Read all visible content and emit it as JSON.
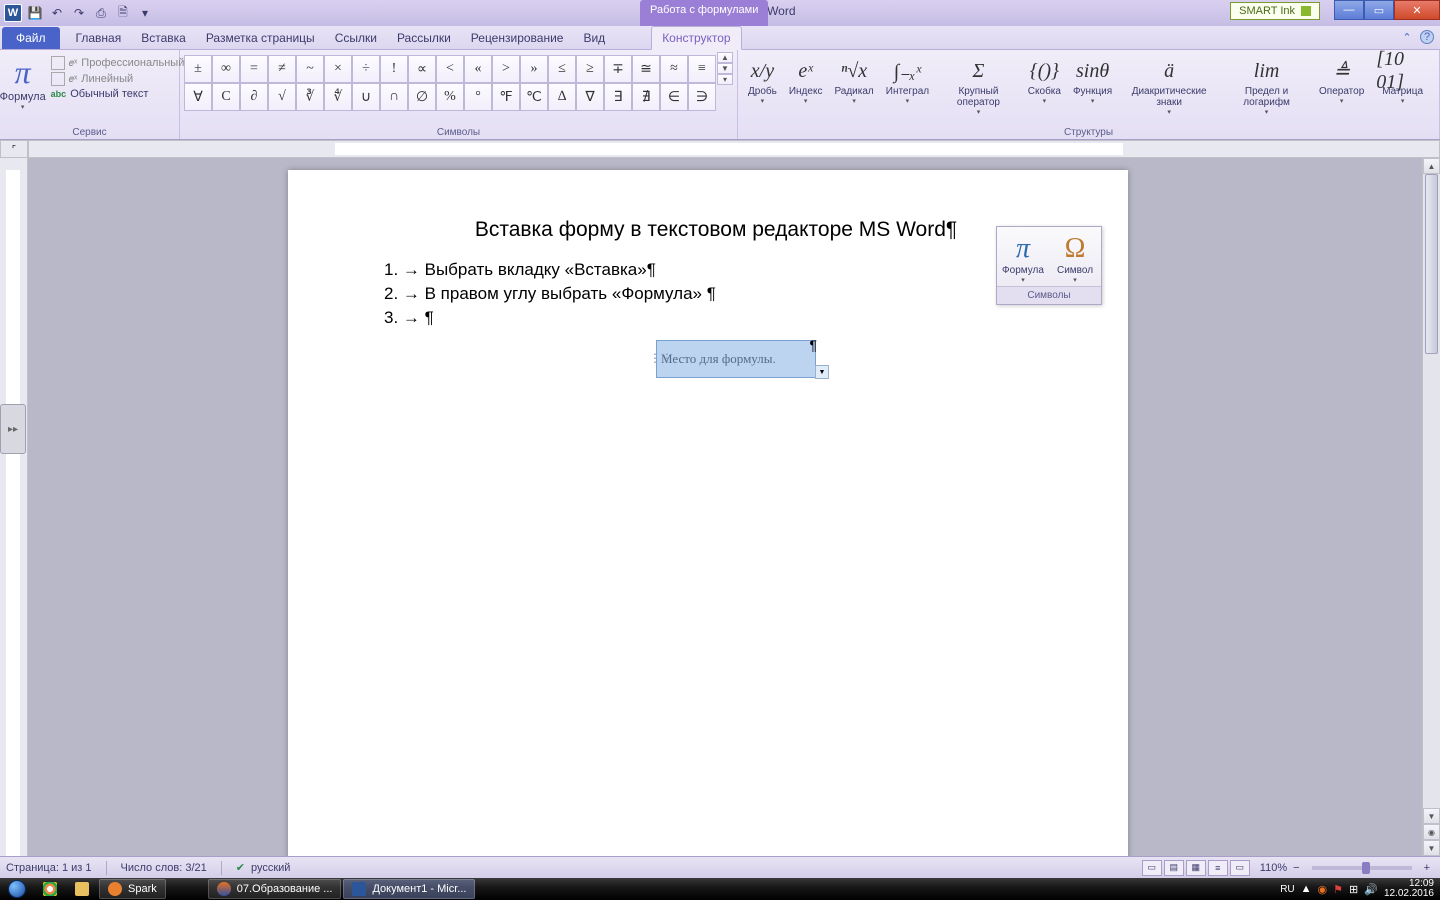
{
  "titlebar": {
    "word_badge": "W",
    "doc_title": "Документ1 - Microsoft Word",
    "context_tab": "Работа с формулами",
    "smartink": "SMART Ink"
  },
  "tabs": {
    "file": "Файл",
    "items": [
      "Главная",
      "Вставка",
      "Разметка страницы",
      "Ссылки",
      "Рассылки",
      "Рецензирование",
      "Вид",
      "Конструктор"
    ],
    "active_index": 7
  },
  "ribbon": {
    "service": {
      "formula": "Формула",
      "opts": {
        "prof": "Профессиональный",
        "linear": "Линейный",
        "plain": "Обычный текст"
      },
      "group_label": "Сервис"
    },
    "symbols": {
      "row1": [
        "±",
        "∞",
        "=",
        "≠",
        "~",
        "×",
        "÷",
        "!",
        "∝",
        "<",
        "«",
        ">",
        "»",
        "≤",
        "≥",
        "∓",
        "≅",
        "≈",
        "≡"
      ],
      "row2": [
        "∀",
        "С",
        "∂",
        "√",
        "∛",
        "∜",
        "∪",
        "∩",
        "∅",
        "%",
        "°",
        "℉",
        "℃",
        "∆",
        "∇",
        "∃",
        "∄",
        "∈",
        "∋"
      ],
      "group_label": "Символы"
    },
    "structures": {
      "items": [
        {
          "icon": "x/y",
          "label": "Дробь"
        },
        {
          "icon": "eˣ",
          "label": "Индекс"
        },
        {
          "icon": "ⁿ√x",
          "label": "Радикал"
        },
        {
          "icon": "∫₋ₓˣ",
          "label": "Интеграл"
        },
        {
          "icon": "Σ",
          "label": "Крупный\nоператор"
        },
        {
          "icon": "{()}",
          "label": "Скобка"
        },
        {
          "icon": "sinθ",
          "label": "Функция"
        },
        {
          "icon": "ä",
          "label": "Диакритические\nзнаки"
        },
        {
          "icon": "lim",
          "label": "Предел и\nлогарифм"
        },
        {
          "icon": "≜",
          "label": "Оператор"
        },
        {
          "icon": "[10\n01]",
          "label": "Матрица"
        }
      ],
      "group_label": "Структуры"
    }
  },
  "document": {
    "title_line": "Вставка форму в текстовом редакторе  MS Word¶",
    "lines": [
      "1. → Выбрать вкладку «Вставка»¶",
      "2. → В правом углу выбрать «Формула»  ¶",
      "3. → ¶"
    ],
    "equation_placeholder": "Место для формулы."
  },
  "float_panel": {
    "formula_label": "Формула",
    "symbol_label": "Символ",
    "footer": "Символы"
  },
  "statusbar": {
    "page": "Страница: 1 из 1",
    "words": "Число слов: 3/21",
    "lang": "русский",
    "zoom": "110%"
  },
  "taskbar": {
    "apps": [
      {
        "label": ""
      },
      {
        "label": ""
      },
      {
        "label": ""
      },
      {
        "label": "Spark"
      },
      {
        "label": ""
      },
      {
        "label": "07.Образование ..."
      },
      {
        "label": "Документ1 - Micr..."
      }
    ],
    "lang": "RU",
    "time": "12:09",
    "date": "12.02.2016"
  }
}
